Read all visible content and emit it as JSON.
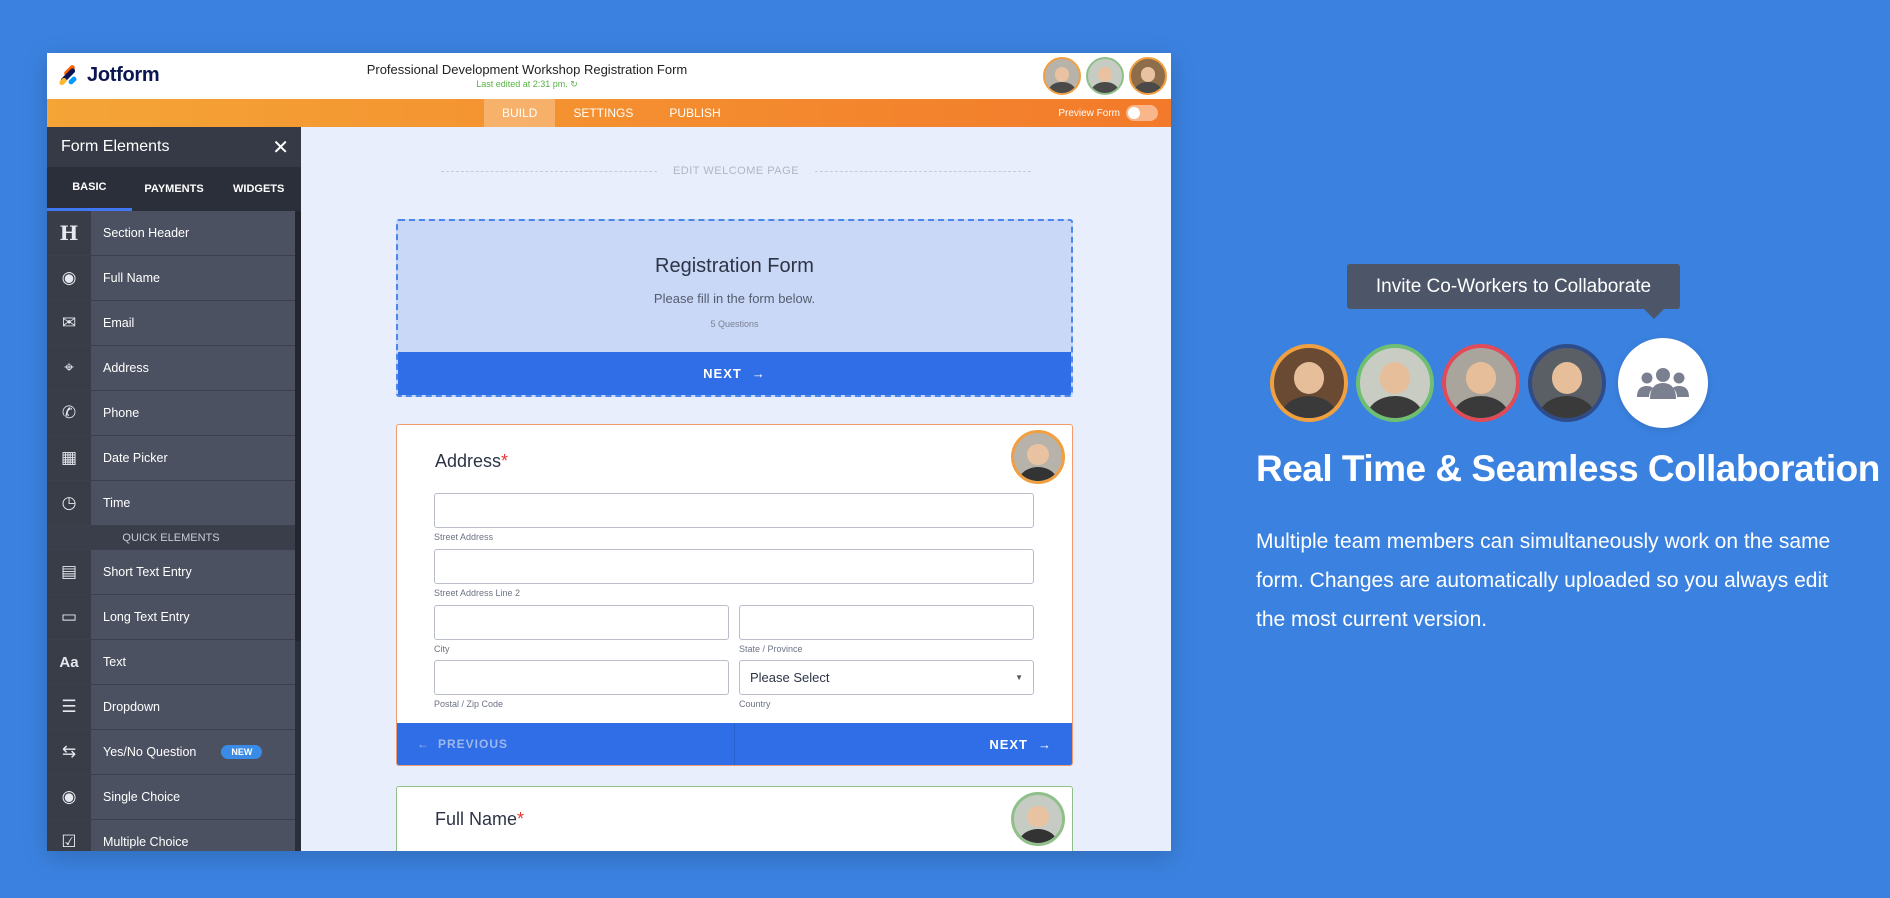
{
  "app": {
    "logo_text": "Jotform",
    "form_title": "Professional Development Workshop Registration Form",
    "last_edited": "Last edited at 2:31 pm. ↻",
    "tabs": [
      "BUILD",
      "SETTINGS",
      "PUBLISH"
    ],
    "active_tab": "BUILD",
    "preview_label": "Preview Form"
  },
  "sidebar": {
    "title": "Form Elements",
    "tabs": [
      "BASIC",
      "PAYMENTS",
      "WIDGETS"
    ],
    "items": [
      {
        "label": "Section Header",
        "icon": "H"
      },
      {
        "label": "Full Name",
        "icon": "◉"
      },
      {
        "label": "Email",
        "icon": "✉"
      },
      {
        "label": "Address",
        "icon": "⌖"
      },
      {
        "label": "Phone",
        "icon": "✆"
      },
      {
        "label": "Date Picker",
        "icon": "▦"
      },
      {
        "label": "Time",
        "icon": "◷"
      }
    ],
    "section_label": "QUICK ELEMENTS",
    "quick_items": [
      {
        "label": "Short Text Entry",
        "icon": "▤"
      },
      {
        "label": "Long Text Entry",
        "icon": "▭"
      },
      {
        "label": "Text",
        "icon": "Aa"
      },
      {
        "label": "Dropdown",
        "icon": "☰"
      },
      {
        "label": "Yes/No Question",
        "icon": "⇆",
        "badge": "NEW"
      },
      {
        "label": "Single Choice",
        "icon": "◉"
      },
      {
        "label": "Multiple Choice",
        "icon": "☑"
      }
    ]
  },
  "canvas": {
    "welcome_label": "EDIT WELCOME PAGE",
    "registration": {
      "title": "Registration Form",
      "subtitle": "Please fill in the form below.",
      "questions": "5 Questions",
      "next_label": "NEXT"
    },
    "address": {
      "label": "Address",
      "required_mark": "*",
      "street_label": "Street Address",
      "street2_label": "Street Address Line 2",
      "city_label": "City",
      "state_label": "State / Province",
      "zip_label": "Postal / Zip Code",
      "country_label": "Country",
      "country_value": "Please Select",
      "prev_label": "PREVIOUS",
      "next_label": "NEXT"
    },
    "full_name": {
      "label": "Full Name",
      "required_mark": "*"
    }
  },
  "promo": {
    "tooltip": "Invite Co-Workers to Collaborate",
    "title": "Real Time & Seamless Collaboration",
    "text": "Multiple team members can simultaneously work on the same form. Changes are automatically uploaded so you always edit the most current version."
  },
  "colors": {
    "background": "#3b82e0",
    "orange_accent": "#f37a2a",
    "button_blue": "#2f6ee6",
    "sidebar": "#444a58"
  }
}
